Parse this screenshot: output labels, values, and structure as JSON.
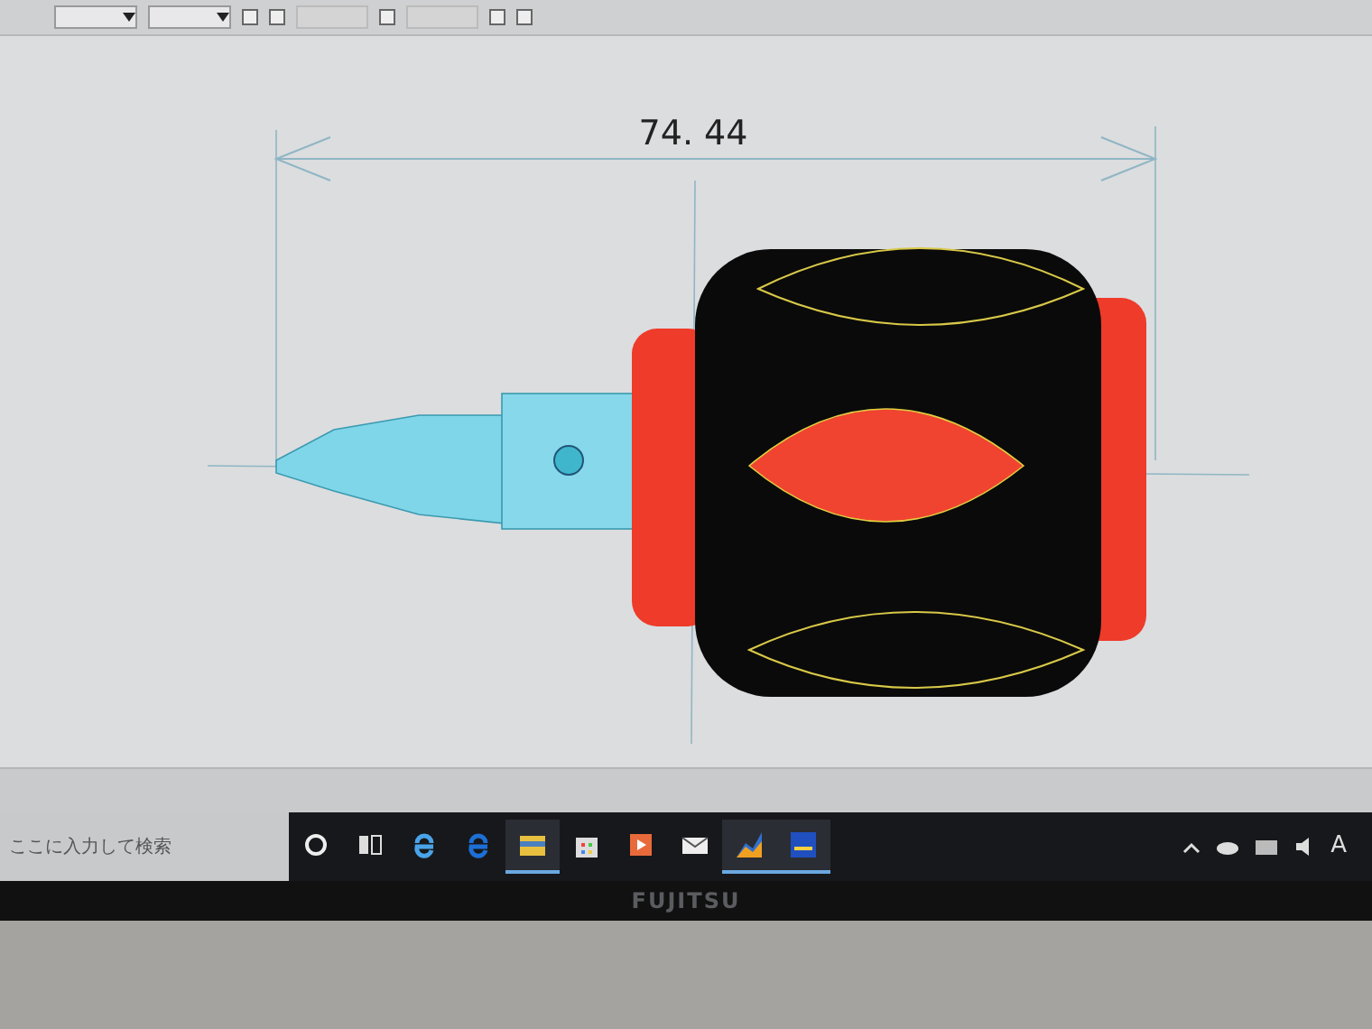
{
  "toolbar": {
    "controls": [
      {
        "kind": "dropdown",
        "disabled": false
      },
      {
        "kind": "dropdown",
        "disabled": false
      },
      {
        "kind": "checkbox",
        "checked": false
      },
      {
        "kind": "checkbox",
        "checked": false
      },
      {
        "kind": "field",
        "disabled": true
      },
      {
        "kind": "checkbox",
        "checked": false
      },
      {
        "kind": "field",
        "disabled": true
      },
      {
        "kind": "checkbox",
        "checked": false
      },
      {
        "kind": "checkbox",
        "checked": false
      }
    ]
  },
  "drawing": {
    "dimension": "74. 44"
  },
  "taskbar": {
    "search": {
      "placeholder": "ここに入力して検索"
    },
    "apps": [
      {
        "kind": "cortana",
        "selected": false
      },
      {
        "kind": "taskview",
        "selected": false
      },
      {
        "kind": "ie",
        "selected": false
      },
      {
        "kind": "edge",
        "selected": false
      },
      {
        "kind": "folder",
        "selected": true
      },
      {
        "kind": "store",
        "selected": false
      },
      {
        "kind": "media",
        "selected": false
      },
      {
        "kind": "mail",
        "selected": false
      },
      {
        "kind": "chart",
        "selected": true
      },
      {
        "kind": "jw",
        "selected": true
      }
    ],
    "ime": "A"
  },
  "laptop": {
    "brand": "FUJITSU"
  }
}
